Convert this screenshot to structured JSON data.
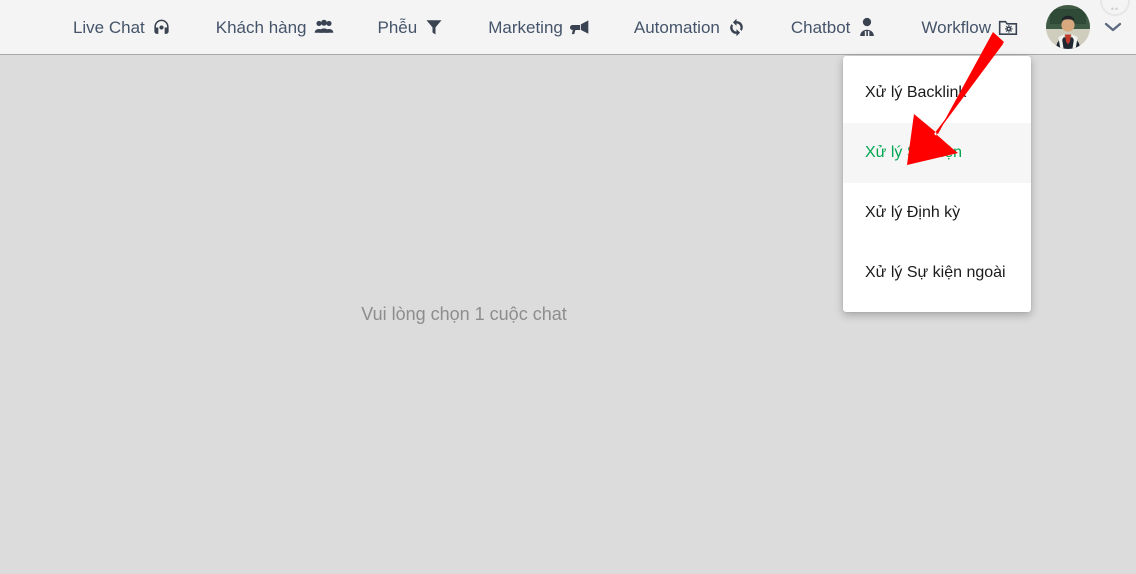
{
  "topbar": {
    "items": [
      {
        "label": "Live Chat",
        "icon": "headset-icon"
      },
      {
        "label": "Khách hàng",
        "icon": "users-icon"
      },
      {
        "label": "Phễu",
        "icon": "funnel-icon"
      },
      {
        "label": "Marketing",
        "icon": "megaphone-icon"
      },
      {
        "label": "Automation",
        "icon": "sync-icon"
      },
      {
        "label": "Chatbot",
        "icon": "robot-icon"
      },
      {
        "label": "Workflow",
        "icon": "folder-gear-icon"
      }
    ],
    "avatar_alt": "user-avatar",
    "caret": "chevron-down-icon",
    "corner_badge_dots": "••"
  },
  "dropdown": {
    "items": [
      {
        "label": "Xử lý Backlink",
        "active": false
      },
      {
        "label": "Xử lý Sự kiện",
        "active": true
      },
      {
        "label": "Xử lý Định kỳ",
        "active": false
      },
      {
        "label": "Xử lý Sự kiện ngoài",
        "active": false
      }
    ]
  },
  "main": {
    "empty_message": "Vui lòng chọn 1 cuộc chat"
  },
  "colors": {
    "header_bg": "#f4f4f4",
    "body_bg": "#dcdcdc",
    "nav_text": "#45546a",
    "menu_bg": "#ffffff",
    "menu_active_bg": "#f6f6f6",
    "menu_active_text": "#00a651",
    "empty_text": "#8d8d8d",
    "arrow": "#ff0000"
  }
}
